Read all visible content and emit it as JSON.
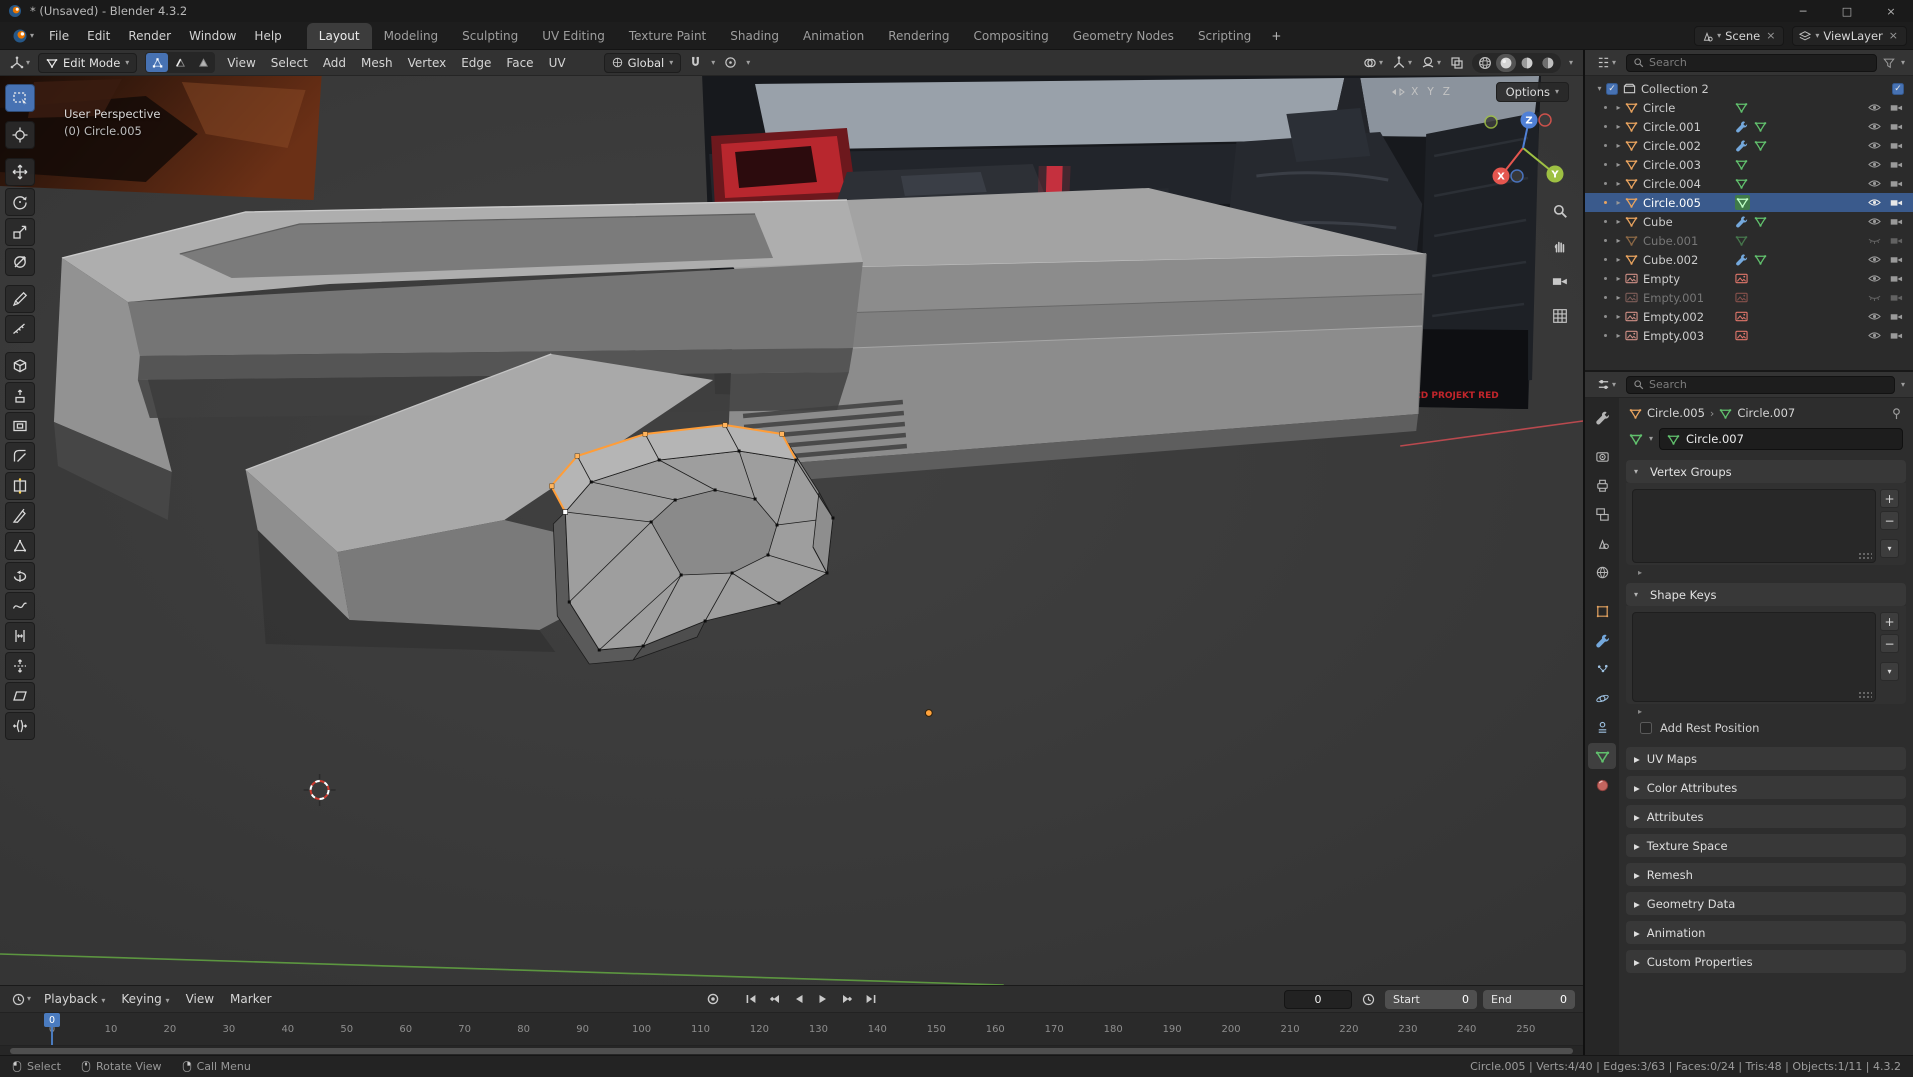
{
  "icons": {
    "chevron_down": "▾",
    "chevron_right": "▸",
    "breadcrumb_separator": "›",
    "minimize": "─",
    "maximize": "□",
    "close": "×",
    "check": "✓",
    "plus": "+",
    "minus": "−"
  },
  "colors": {
    "accent_blue": "#4772b3",
    "selection_orange": "#ff9d38",
    "axis_x_red": "#e5564f",
    "axis_y_green": "#9ec043",
    "axis_z_blue": "#5080d6",
    "logo_red": "#c2252b"
  },
  "titlebar": {
    "title": "* (Unsaved) - Blender 4.3.2"
  },
  "topbar": {
    "menus": [
      "File",
      "Edit",
      "Render",
      "Window",
      "Help"
    ],
    "workspaces": [
      "Layout",
      "Modeling",
      "Sculpting",
      "UV Editing",
      "Texture Paint",
      "Shading",
      "Animation",
      "Rendering",
      "Compositing",
      "Geometry Nodes",
      "Scripting"
    ],
    "active_workspace": "Layout",
    "scene": {
      "label": "Scene"
    },
    "view_layer": {
      "label": "ViewLayer"
    }
  },
  "viewport_header": {
    "mode": "Edit Mode",
    "menus": [
      "View",
      "Select",
      "Add",
      "Mesh",
      "Vertex",
      "Edge",
      "Face",
      "UV"
    ],
    "orientation": "Global"
  },
  "viewport": {
    "overlay": {
      "perspective": "User Perspective",
      "object": "(0) Circle.005"
    },
    "options_button": "Options",
    "mirror_axes": [
      "X",
      "Y",
      "Z"
    ],
    "gizmo": {
      "x": "X",
      "y": "Y",
      "z": "Z"
    },
    "reference_logo": "CD PROJEKT RED"
  },
  "outliner": {
    "search_placeholder": "Search",
    "collection": {
      "label": "Collection 2"
    },
    "items": [
      {
        "label": "Circle",
        "type": "mesh",
        "state": "normal"
      },
      {
        "label": "Circle.001",
        "type": "mesh-modifier",
        "state": "normal"
      },
      {
        "label": "Circle.002",
        "type": "mesh-modifier",
        "state": "normal"
      },
      {
        "label": "Circle.003",
        "type": "mesh",
        "state": "normal"
      },
      {
        "label": "Circle.004",
        "type": "mesh",
        "state": "normal"
      },
      {
        "label": "Circle.005",
        "type": "mesh",
        "state": "selected"
      },
      {
        "label": "Cube",
        "type": "mesh-modifier",
        "state": "normal"
      },
      {
        "label": "Cube.001",
        "type": "mesh",
        "state": "hidden"
      },
      {
        "label": "Cube.002",
        "type": "mesh-modifier",
        "state": "normal"
      },
      {
        "label": "Empty",
        "type": "image",
        "state": "normal"
      },
      {
        "label": "Empty.001",
        "type": "image",
        "state": "hidden"
      },
      {
        "label": "Empty.002",
        "type": "image",
        "state": "normal"
      },
      {
        "label": "Empty.003",
        "type": "image",
        "state": "normal"
      }
    ]
  },
  "properties": {
    "search_placeholder": "Search",
    "breadcrumb": {
      "object": "Circle.005",
      "data": "Circle.007"
    },
    "name_field": "Circle.007",
    "panels": {
      "vertex_groups": "Vertex Groups",
      "shape_keys": "Shape Keys",
      "add_rest_position": "Add Rest Position",
      "collapsed": [
        "UV Maps",
        "Color Attributes",
        "Attributes",
        "Texture Space",
        "Remesh",
        "Geometry Data",
        "Animation",
        "Custom Properties"
      ]
    }
  },
  "timeline": {
    "menus": [
      "Playback",
      "Keying",
      "View",
      "Marker"
    ],
    "current_frame": "0",
    "playhead": "0",
    "start": {
      "label": "Start",
      "value": "0"
    },
    "end": {
      "label": "End",
      "value": "0"
    },
    "ticks": [
      "0",
      "10",
      "20",
      "30",
      "40",
      "50",
      "60",
      "70",
      "80",
      "90",
      "100",
      "110",
      "120",
      "130",
      "140",
      "150",
      "160",
      "170",
      "180",
      "190",
      "200",
      "210",
      "220",
      "230",
      "240",
      "250"
    ]
  },
  "statusbar": {
    "hints": [
      "Select",
      "Rotate View",
      "Call Menu"
    ],
    "stats": "Circle.005 | Verts:4/40 | Edges:3/63 | Faces:0/24 | Tris:48 | Objects:1/11 | 4.3.2"
  }
}
